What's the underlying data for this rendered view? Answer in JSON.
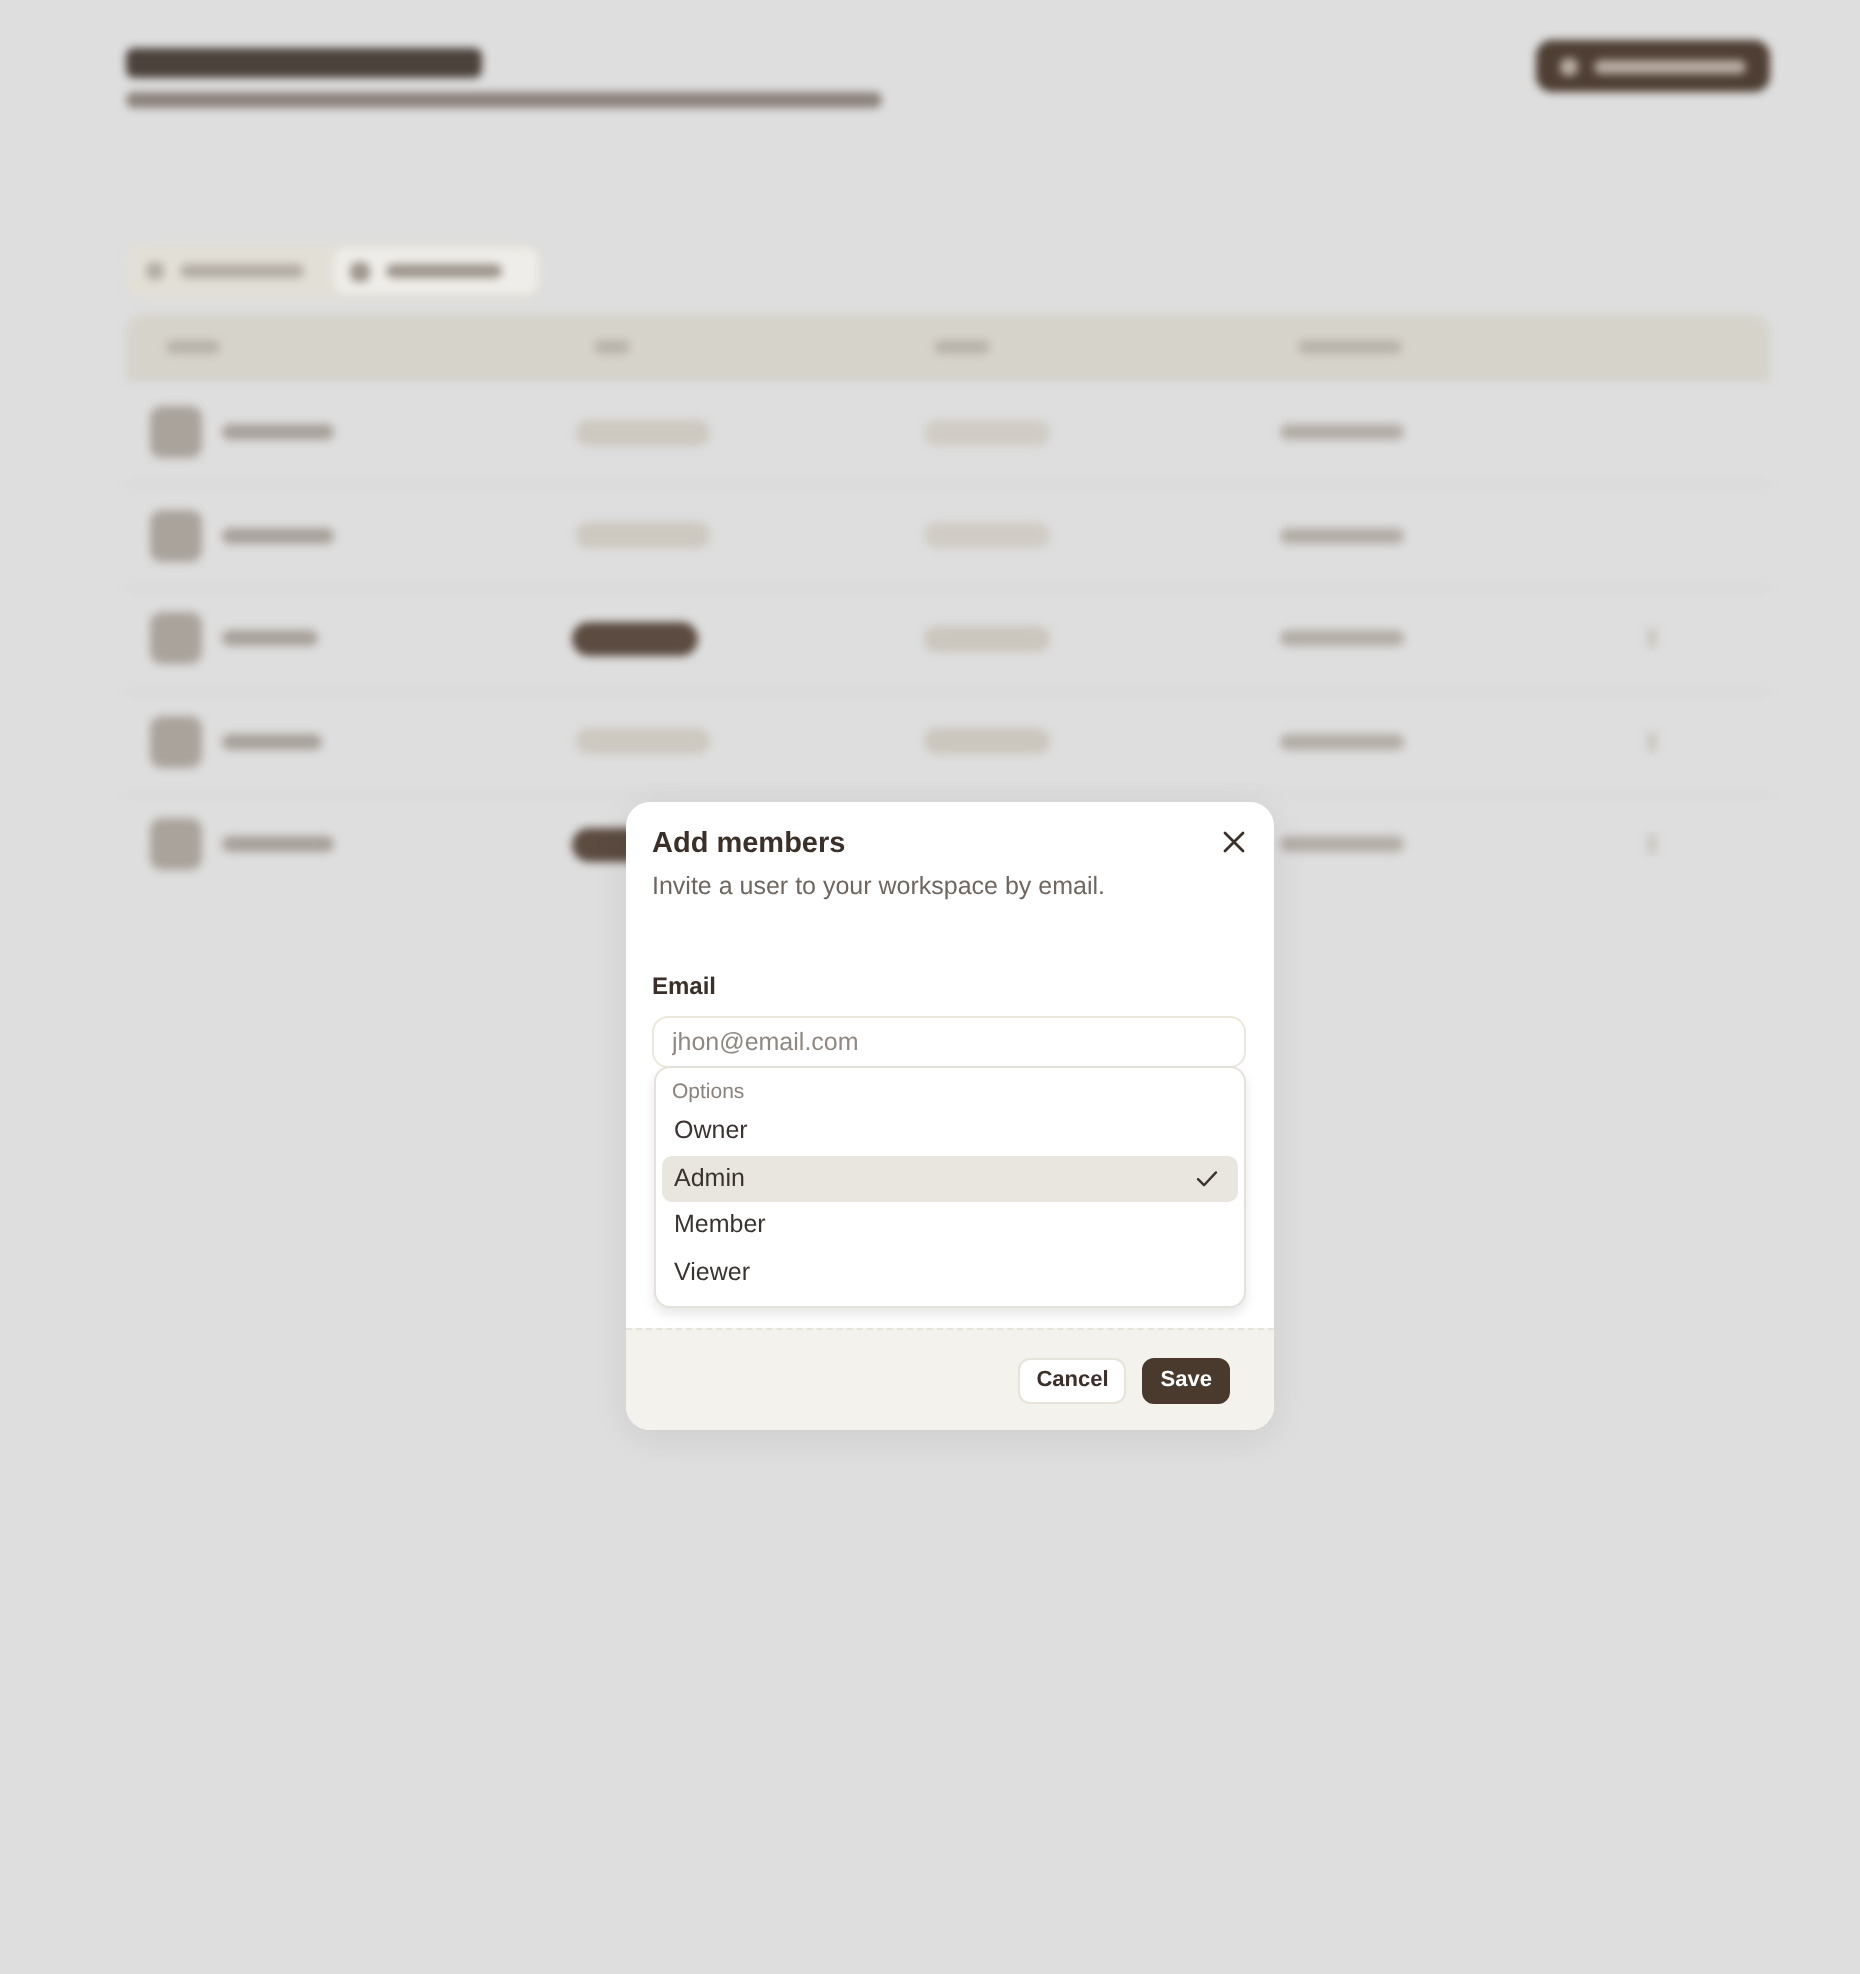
{
  "dialog": {
    "title": "Add members",
    "description": "Invite a user to your workspace by email.",
    "email_field": {
      "label": "Email",
      "placeholder": "jhon@email.com"
    },
    "role_menu": {
      "group_label": "Options",
      "options": [
        {
          "label": "Owner",
          "selected": false
        },
        {
          "label": "Admin",
          "selected": true
        },
        {
          "label": "Member",
          "selected": false
        },
        {
          "label": "Viewer",
          "selected": false
        }
      ]
    },
    "buttons": [
      {
        "label": "Cancel",
        "kind": "secondary"
      },
      {
        "label": "Save",
        "kind": "primary"
      }
    ]
  }
}
